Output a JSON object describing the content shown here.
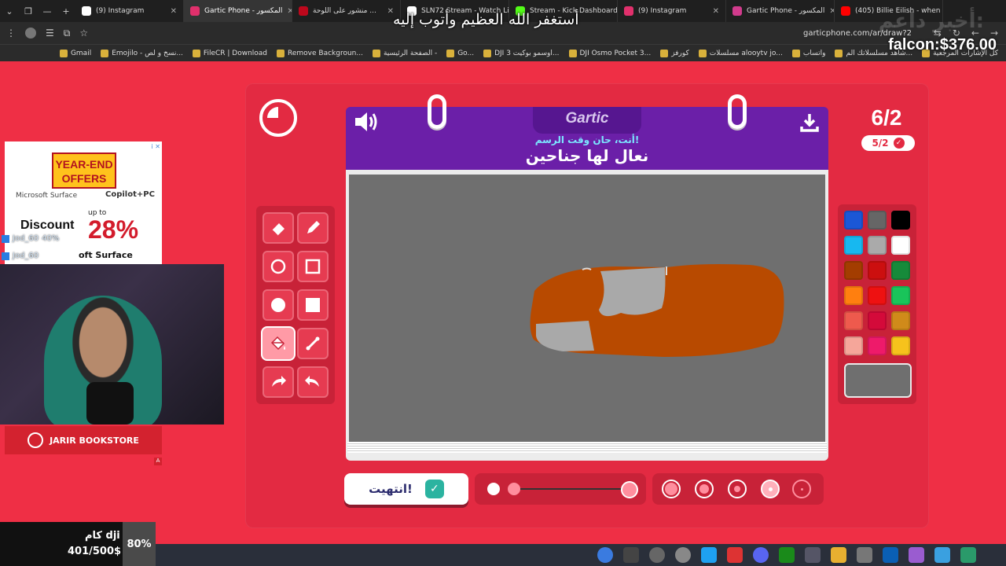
{
  "browser": {
    "tabs": [
      {
        "label": "(9) Instagram",
        "favicon_color": "#ffffff"
      },
      {
        "label": "Gartic Phone - المكسور",
        "favicon_color": "#e1306c",
        "active": true
      },
      {
        "label": "منشور على اللوحة ...",
        "favicon_color": "#bd081c"
      },
      {
        "label": "SLN72 Stream - Watch Li...",
        "favicon_color": "#ffffff"
      },
      {
        "label": "Stream - Kick Dashboard",
        "favicon_color": "#53fc18"
      },
      {
        "label": "(9) Instagram",
        "favicon_color": "#e1306c"
      },
      {
        "label": "Gartic Phone - المكسور",
        "favicon_color": "#d13b8c"
      },
      {
        "label": "(405) Billie Eilish - when",
        "favicon_color": "#ff0000"
      }
    ],
    "url": "garticphone.com/ar/draw?2",
    "bookmarks": [
      "كل الإشارات المرجعية",
      "شاهد مسلسلاتك الم...",
      "واتساب",
      "مسلسلات alooytv jo...",
      "كورفز",
      "DJI Osmo Pocket 3...",
      "DJI اوسمو بوكيت 3...",
      "Go...",
      "الصفحة الرئيسية -",
      "Remove Backgroun...",
      "FileCR | Download",
      "Emojilo - نسخ و لص...",
      "Gmail"
    ]
  },
  "overlay": {
    "dua": "أستغفر الله العظيم وأتوب إليه",
    "falcon": "falcon:$376.00",
    "faded_text": "أخبر داعم:"
  },
  "game": {
    "logo": "Gartic",
    "prompt_sub": "أنت، حان وقت الرسم!",
    "prompt": "نعال لها جناحين",
    "round": "6/2",
    "round_pill": "5/2",
    "done_button": "انتهيت!",
    "tools": [
      "eraser-icon",
      "pencil-icon",
      "circle-outline-icon",
      "square-outline-icon",
      "circle-filled-icon",
      "square-filled-icon",
      "fill-bucket-icon",
      "line-icon",
      "undo-icon",
      "redo-icon"
    ],
    "selected_tool": "fill-bucket-icon",
    "palette": [
      "#1b57d6",
      "#666666",
      "#000000",
      "#17b8f0",
      "#aaaaaa",
      "#ffffff",
      "#a33d00",
      "#cc0f0f",
      "#168a3a",
      "#ff7f0f",
      "#ee1111",
      "#19c45a",
      "#ee5a4d",
      "#d40a3a",
      "#d08a1a",
      "#f5a69a",
      "#ee1a6a",
      "#f6c21c"
    ],
    "current_color": "#6f6f6f",
    "canvas_bg": "#6f6f6f",
    "drawing_colors": {
      "body": "#b84a00",
      "patch": "#a9a9a9"
    },
    "opacity_level": 1.0,
    "brush_sizes": 5,
    "selected_size_index": 3
  },
  "stream": {
    "ad": {
      "title": "YEAR-END OFFERS",
      "brand1": "Microsoft Surface",
      "brand2": "Copilot+PC",
      "upto": "up to",
      "percent": "28%",
      "discount": "Discount",
      "surface": "oft Surface",
      "ad_info": "i ✕"
    },
    "chat": [
      {
        "name": "Jod_60",
        "msg": "40%"
      },
      {
        "name": "Jod_60",
        "msg": ""
      }
    ],
    "jarir": "JARIR BOOKSTORE",
    "goal": {
      "title": "كام dji",
      "value": "401/500$",
      "percent": "80%"
    }
  }
}
